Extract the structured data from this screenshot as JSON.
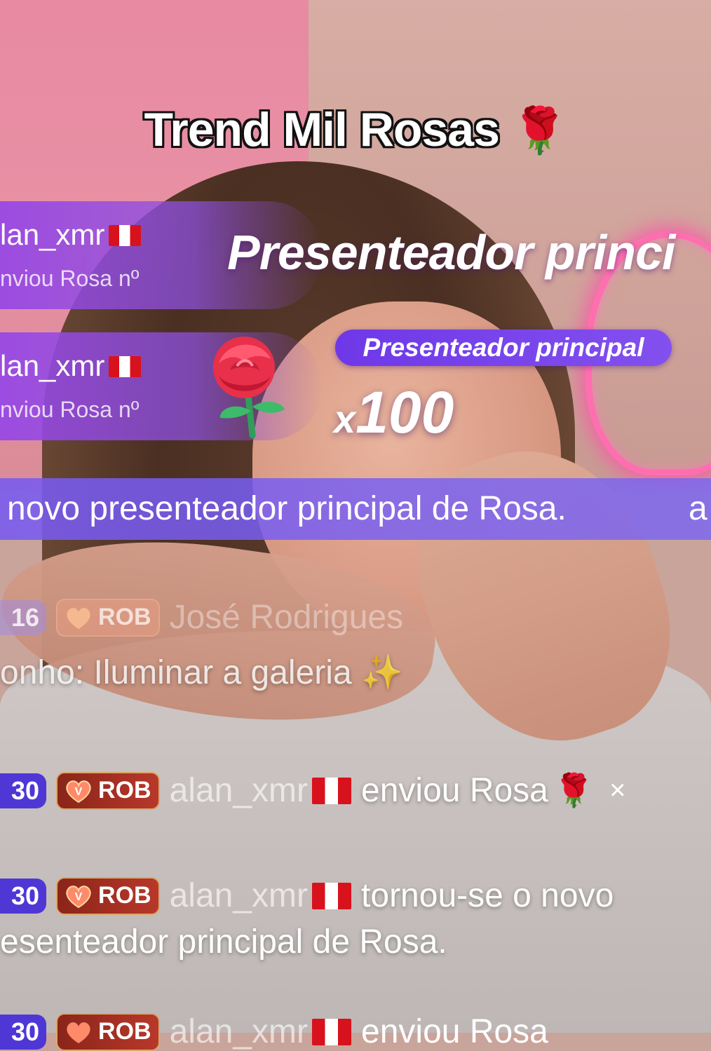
{
  "caption": {
    "text": "Trend Mil Rosas",
    "emoji": "🌹"
  },
  "gift_cards": [
    {
      "username": "lan_xmr",
      "description": "nviou Rosa nº"
    },
    {
      "username": "lan_xmr",
      "description": "nviou Rosa nº"
    }
  ],
  "top_gifter": {
    "banner": "Presenteador princi",
    "pill": "Presenteador principal",
    "combo_prefix": "x",
    "combo_count": "100"
  },
  "ticker": {
    "text": "novo presenteador principal de Rosa.",
    "trailing": "a"
  },
  "chat": {
    "faded_row": {
      "level": "16",
      "badge": "ROB",
      "name": "José Rodrigues"
    },
    "sonho_line": "onho: Iluminar a galeria",
    "sparkle": "✨",
    "rows": [
      {
        "level": "30",
        "badge": "ROB",
        "name": "alan_xmr",
        "message": "enviou Rosa",
        "suffix": "×"
      },
      {
        "level": "30",
        "badge": "ROB",
        "name": "alan_xmr",
        "message": "tornou-se o novo"
      }
    ],
    "continuation": "esenteador principal de Rosa.",
    "bottom_row": {
      "level": "30",
      "badge": "ROB",
      "name": "alan_xmr",
      "message": "enviou Rosa"
    }
  },
  "colors": {
    "level_badge": "#4f37d6",
    "tier_badge": "#b8382a",
    "banner_purple": "#8a4fe6",
    "neon": "#ff6fb0",
    "flag_red": "#d8121c"
  },
  "icons": [
    "rose-icon",
    "peru-flag-icon",
    "heart-v-badge-icon",
    "sparkles-icon"
  ]
}
